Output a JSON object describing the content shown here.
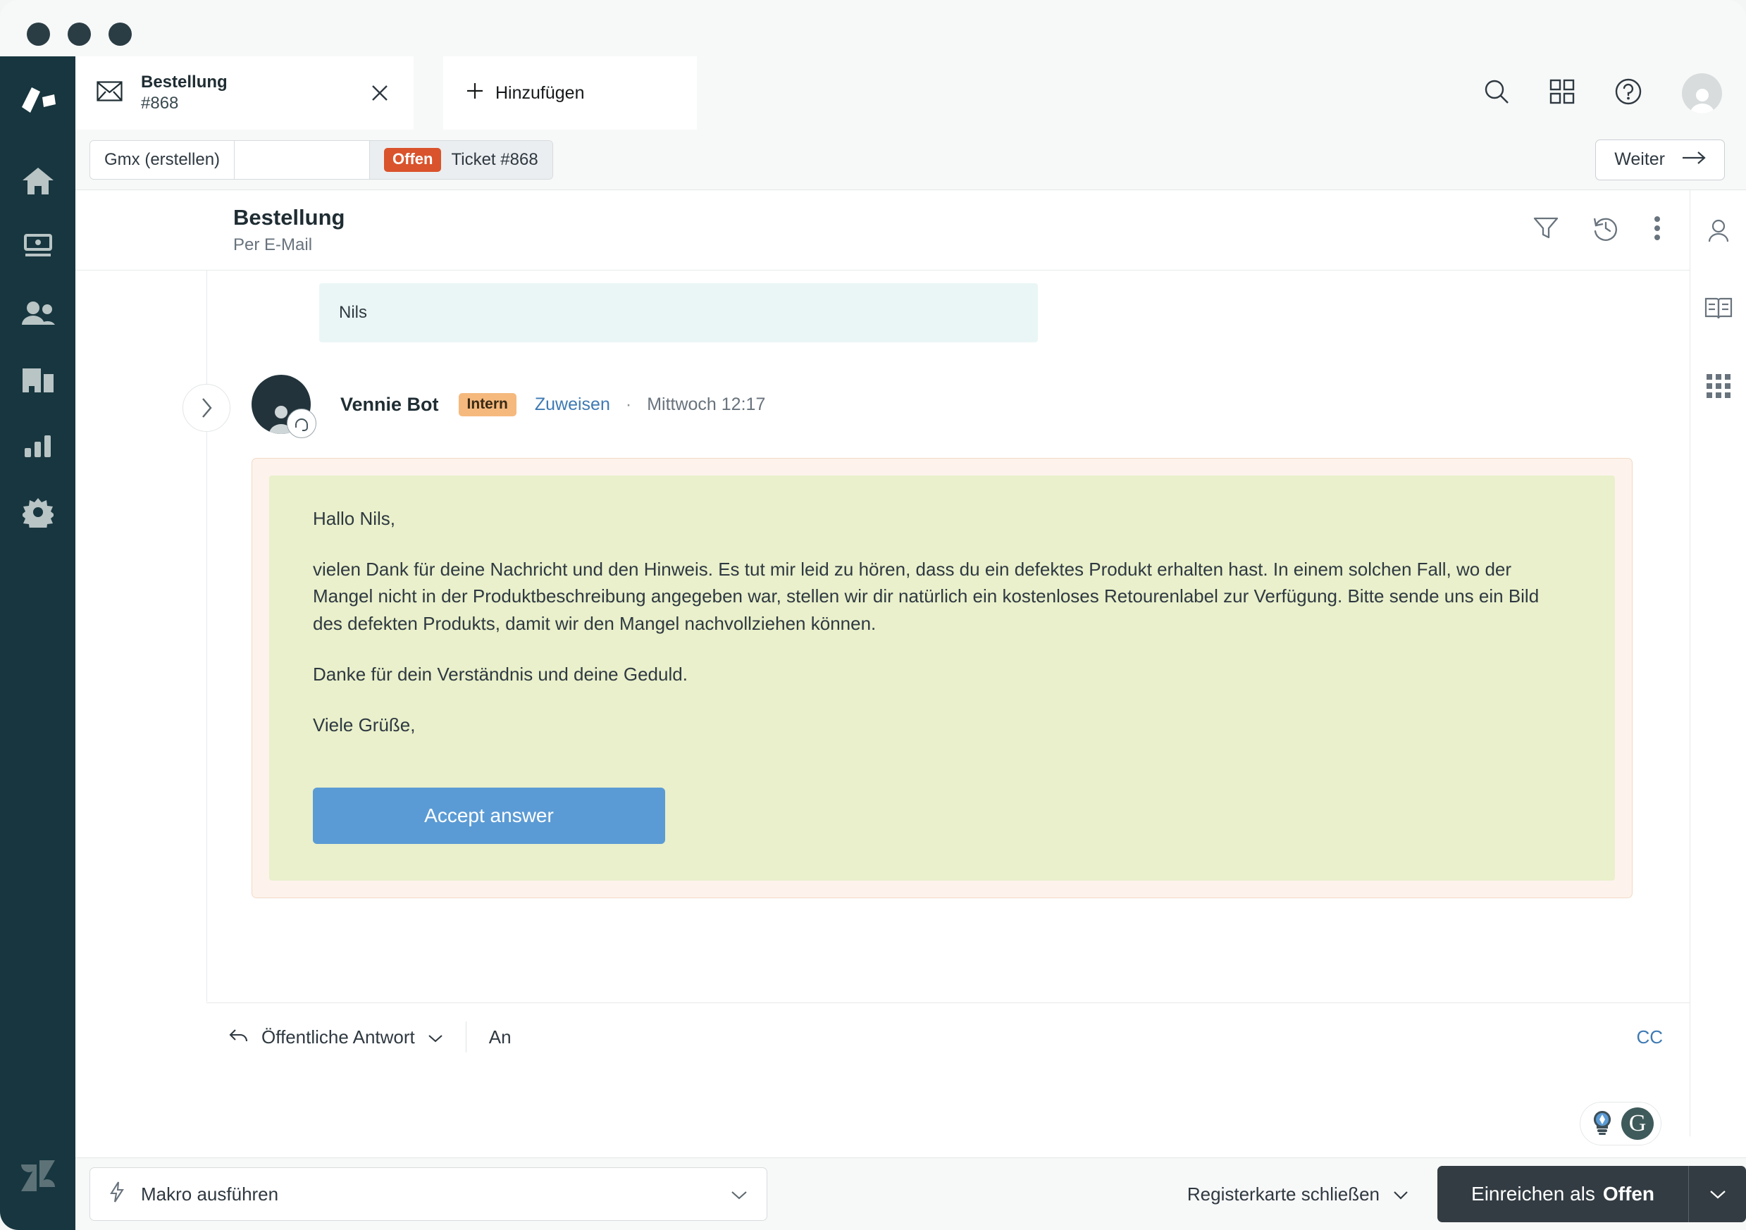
{
  "window": {
    "traffic_lights": [
      "close",
      "minimize",
      "maximize"
    ]
  },
  "tabs": {
    "active": {
      "icon": "mail-icon",
      "title": "Bestellung",
      "subtitle": "#868",
      "close_label": "×"
    },
    "add_label": "Hinzufügen",
    "add_icon": "plus-icon"
  },
  "top_actions": {
    "search": "search-icon",
    "apps": "apps-grid-icon",
    "help": "help-circle-icon",
    "avatar": "user-avatar"
  },
  "sub_bar": {
    "path": [
      {
        "label": "Gmx (erstellen)"
      },
      {
        "label": ""
      }
    ],
    "status_badge": "Offen",
    "current_label": "Ticket #868",
    "next_button": "Weiter"
  },
  "ticket": {
    "title": "Bestellung",
    "channel": "Per E-Mail",
    "actions": [
      "filter-icon",
      "history-icon",
      "more-options-icon"
    ]
  },
  "right_rail": {
    "items": [
      "user-profile-icon",
      "knowledge-book-icon",
      "apps-grid-icon"
    ]
  },
  "conversation": {
    "prior_message": "Nils",
    "message": {
      "author": "Vennie Bot",
      "badge": "Intern",
      "assign_link": "Zuweisen",
      "separator": "·",
      "timestamp": "Mittwoch 12:17",
      "paragraphs": [
        "Hallo Nils,",
        "vielen Dank für deine Nachricht und den Hinweis. Es tut mir leid zu hören, dass du ein defektes Produkt erhalten hast. In einem solchen Fall, wo der Mangel nicht in der Produktbeschreibung angegeben war, stellen wir dir natürlich ein kostenloses Retourenlabel zur Verfügung. Bitte sende uns ein Bild des defekten Produkts, damit wir den Mangel nachvollziehen können.",
        "Danke für dein Verständnis und deine Geduld.",
        "Viele Grüße,"
      ],
      "accept_button": "Accept answer"
    }
  },
  "composer": {
    "channel": "Öffentliche Antwort",
    "to_label": "An",
    "cc_label": "CC",
    "tools": [
      "compose-icon",
      "text-format-icon",
      "emoji-icon",
      "attachment-icon",
      "link-icon"
    ],
    "assist_badges": [
      "lightbulb-icon",
      "grammarly-icon"
    ],
    "grammarly_letter": "G"
  },
  "footer": {
    "macro_label": "Makro ausführen",
    "macro_icon": "lightning-icon",
    "close_tab_label": "Registerkarte schließen",
    "submit_prefix": "Einreichen als",
    "submit_status": "Offen"
  },
  "colors": {
    "rail_bg": "#17363f",
    "status_open": "#d9532c",
    "intern_badge": "#f5b97e",
    "link": "#3e7ab3",
    "accept_button": "#5b9bd5",
    "answer_card_bg": "#fdf3ec",
    "answer_inner_bg": "#e9f0cb",
    "submit_button": "#333c42"
  }
}
